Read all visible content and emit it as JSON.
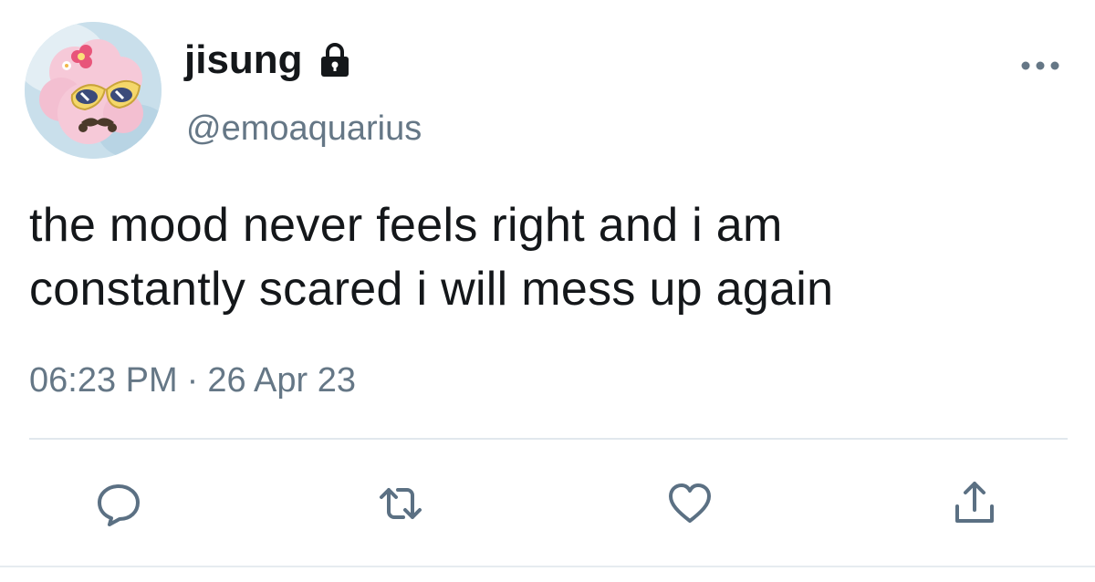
{
  "user": {
    "display_name": "jisung",
    "handle": "@emoaquarius",
    "protected": true,
    "avatar_icon": "pink-sheep-with-sunglasses-avatar"
  },
  "tweet": {
    "text_lines": [
      "the mood never feels right and i am",
      "constantly scared i will mess up again"
    ],
    "time": "06:23 PM",
    "separator": "·",
    "date": "26 Apr 23"
  },
  "actions": {
    "reply_icon": "reply-icon",
    "retweet_icon": "retweet-icon",
    "like_icon": "heart-icon",
    "share_icon": "share-icon",
    "more_icon": "more-options-icon"
  },
  "colors": {
    "text": "#14171a",
    "secondary": "#657786",
    "icon": "#5b7083",
    "divider": "#e1e8ed"
  }
}
